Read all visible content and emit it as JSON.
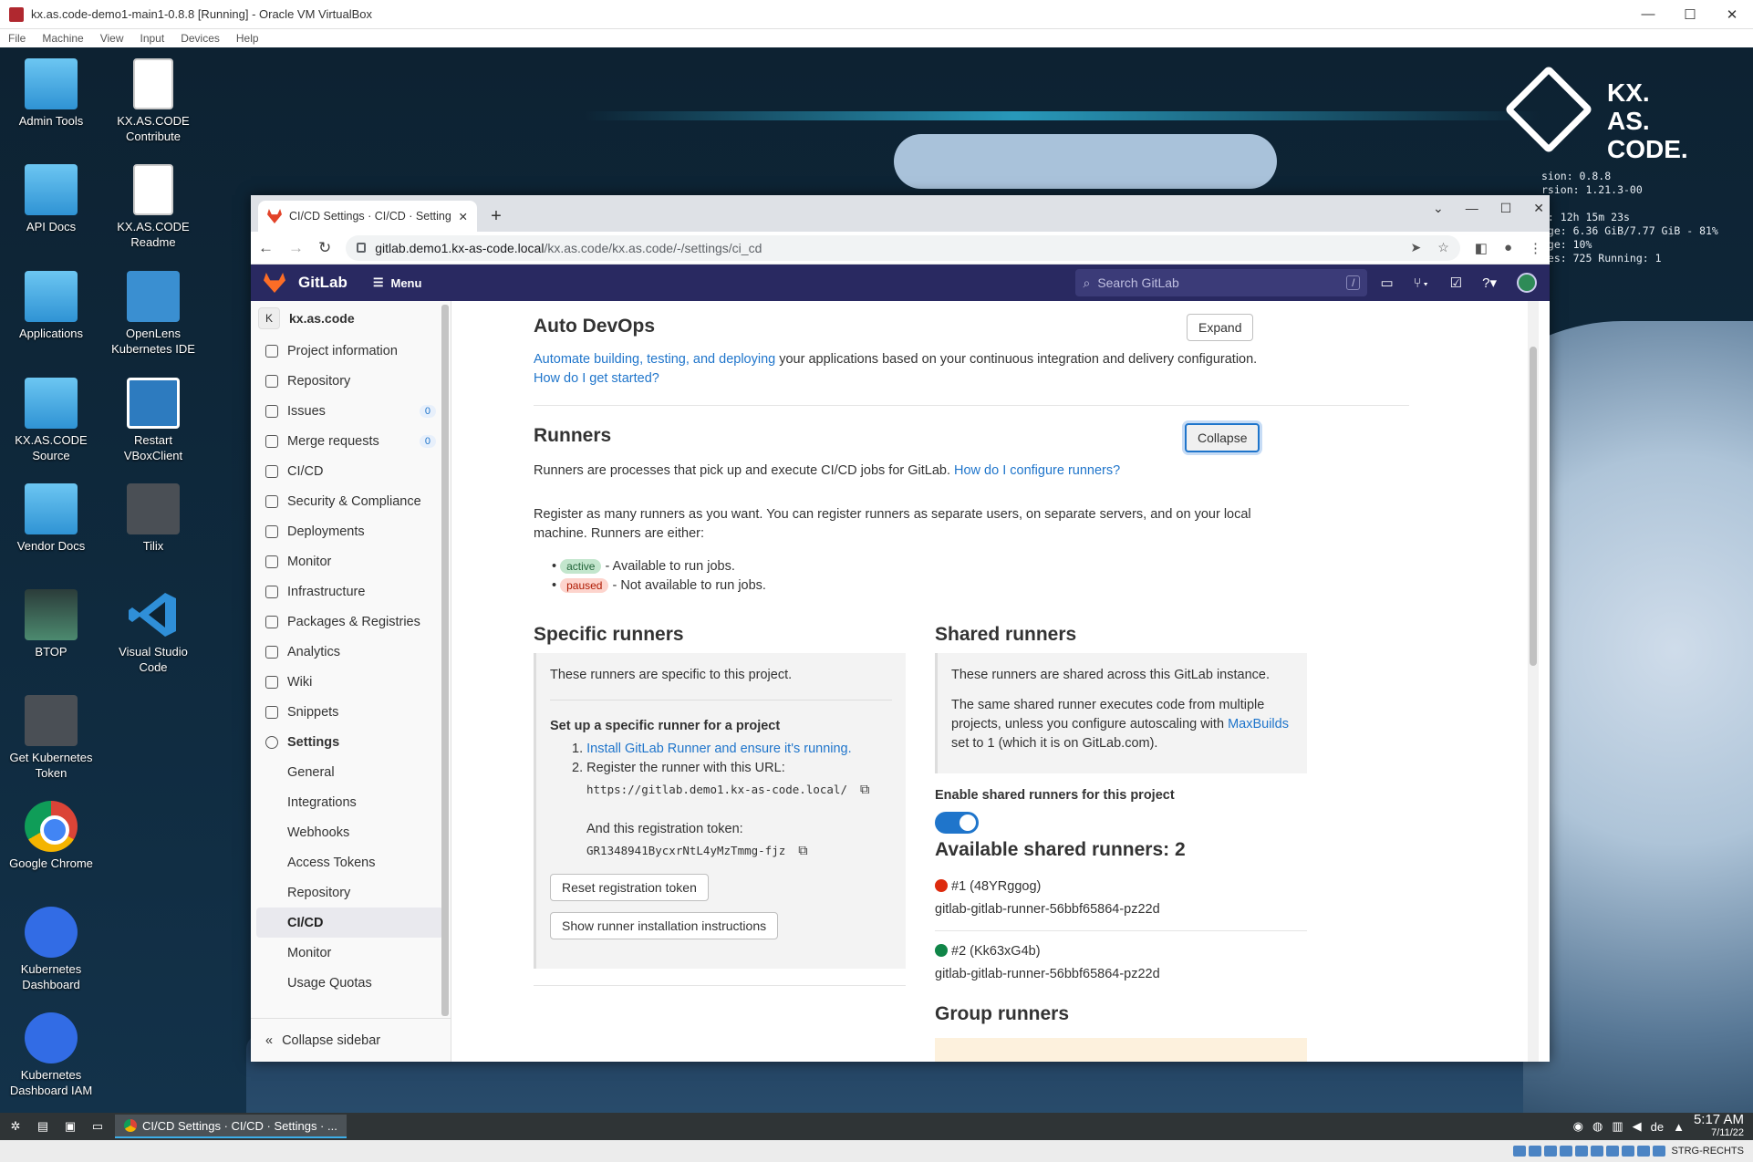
{
  "vbox": {
    "title": "kx.as.code-demo1-main1-0.8.8 [Running] - Oracle VM VirtualBox",
    "menu": [
      "File",
      "Machine",
      "View",
      "Input",
      "Devices",
      "Help"
    ],
    "status_right": "STRG-RECHTS"
  },
  "desktop": {
    "logo": "KX.\nAS.\nCODE.",
    "btop_lines": [
      "sion: 0.8.8",
      "rsion: 1.21.3-00",
      "",
      "e: 12h 15m 23s",
      "age: 6.36 GiB/7.77 GiB - 81%",
      "age: 10%",
      "ses: 725  Running: 1"
    ],
    "icons_left": [
      {
        "label": "Admin Tools",
        "kind": "folder"
      },
      {
        "label": "API Docs",
        "kind": "folder"
      },
      {
        "label": "Applications",
        "kind": "folder"
      },
      {
        "label": "KX.AS.CODE Source",
        "kind": "folder"
      },
      {
        "label": "Vendor Docs",
        "kind": "folder"
      },
      {
        "label": "BTOP",
        "kind": "btop"
      },
      {
        "label": "Get Kubernetes Token",
        "kind": "tilix"
      },
      {
        "label": "Google Chrome",
        "kind": "chrome"
      },
      {
        "label": "Kubernetes Dashboard",
        "kind": "k8s"
      },
      {
        "label": "Kubernetes Dashboard IAM",
        "kind": "k8s"
      }
    ],
    "icons_right": [
      {
        "label": "KX.AS.CODE Contribute",
        "kind": "doc"
      },
      {
        "label": "KX.AS.CODE Readme",
        "kind": "doc"
      },
      {
        "label": "OpenLens Kubernetes IDE",
        "kind": "lens"
      },
      {
        "label": "Restart VBoxClient",
        "kind": "vbox"
      },
      {
        "label": "Tilix",
        "kind": "tilix"
      },
      {
        "label": "Visual Studio Code",
        "kind": "vscode"
      }
    ]
  },
  "taskbar": {
    "task_label": "CI/CD Settings · CI/CD · Settings · ...",
    "lang": "de",
    "time": "5:17 AM",
    "date": "7/11/22"
  },
  "browser": {
    "tab_title": "CI/CD Settings · CI/CD · Settings",
    "url_host": "gitlab.demo1.kx-as-code.local",
    "url_path": "/kx.as.code/kx.as.code/-/settings/ci_cd"
  },
  "gitlab": {
    "brand": "GitLab",
    "menu": "Menu",
    "search_placeholder": "Search GitLab",
    "search_key": "/",
    "project": {
      "initial": "K",
      "name": "kx.as.code"
    },
    "nav": [
      {
        "label": "Project information",
        "count": null,
        "icon": "info-icon"
      },
      {
        "label": "Repository",
        "count": null,
        "icon": "book-icon"
      },
      {
        "label": "Issues",
        "count": "0",
        "icon": "issues-icon"
      },
      {
        "label": "Merge requests",
        "count": "0",
        "icon": "merge-request-icon"
      },
      {
        "label": "CI/CD",
        "count": null,
        "icon": "rocket-icon"
      },
      {
        "label": "Security & Compliance",
        "count": null,
        "icon": "shield-icon"
      },
      {
        "label": "Deployments",
        "count": null,
        "icon": "deployments-icon"
      },
      {
        "label": "Monitor",
        "count": null,
        "icon": "monitor-icon"
      },
      {
        "label": "Infrastructure",
        "count": null,
        "icon": "cloud-gear-icon"
      },
      {
        "label": "Packages & Registries",
        "count": null,
        "icon": "package-icon"
      },
      {
        "label": "Analytics",
        "count": null,
        "icon": "chart-icon"
      },
      {
        "label": "Wiki",
        "count": null,
        "icon": "book-icon"
      },
      {
        "label": "Snippets",
        "count": null,
        "icon": "scissors-icon"
      }
    ],
    "settings_label": "Settings",
    "settings_sub": [
      "General",
      "Integrations",
      "Webhooks",
      "Access Tokens",
      "Repository",
      "CI/CD",
      "Monitor",
      "Usage Quotas"
    ],
    "collapse_sidebar": "Collapse sidebar"
  },
  "content": {
    "autodevops": {
      "title": "Auto DevOps",
      "expand": "Expand",
      "link1": "Automate building, testing, and deploying",
      "text1": " your applications based on your continuous integration and delivery configuration.",
      "link2": "How do I get started?"
    },
    "runners": {
      "title": "Runners",
      "collapse": "Collapse",
      "desc": "Runners are processes that pick up and execute CI/CD jobs for GitLab. ",
      "desc_link": "How do I configure runners?",
      "register": "Register as many runners as you want. You can register runners as separate users, on separate servers, and on your local machine. Runners are either:",
      "active_badge": "active",
      "active_text": " - Available to run jobs.",
      "paused_badge": "paused",
      "paused_text": " - Not available to run jobs."
    },
    "specific": {
      "title": "Specific runners",
      "intro": "These runners are specific to this project.",
      "setup_title": "Set up a specific runner for a project",
      "step1_num": "1.",
      "step1": "Install GitLab Runner and ensure it's running.",
      "step2_num": "2.",
      "step2": "Register the runner with this URL:",
      "url": "https://gitlab.demo1.kx-as-code.local/",
      "token_label": "And this registration token:",
      "token": "GR1348941BycxrNtL4yMzTmmg-fjz",
      "reset_btn": "Reset registration token",
      "show_btn": "Show runner installation instructions"
    },
    "shared": {
      "title": "Shared runners",
      "p1": "These runners are shared across this GitLab instance.",
      "p2a": "The same shared runner executes code from multiple projects, unless you configure autoscaling with ",
      "p2link": "MaxBuilds",
      "p2b": " set to 1 (which it is on GitLab.com).",
      "enable_label": "Enable shared runners for this project",
      "enabled": true,
      "available": "Available shared runners: 2",
      "runners": [
        {
          "id": "#1 (48YRggog)",
          "name": "gitlab-gitlab-runner-56bbf65864-pz22d",
          "status_color": "#dd2b0e"
        },
        {
          "id": "#2 (Kk63xG4b)",
          "name": "gitlab-gitlab-runner-56bbf65864-pz22d",
          "status_color": "#108548"
        }
      ],
      "group_title": "Group runners"
    }
  }
}
